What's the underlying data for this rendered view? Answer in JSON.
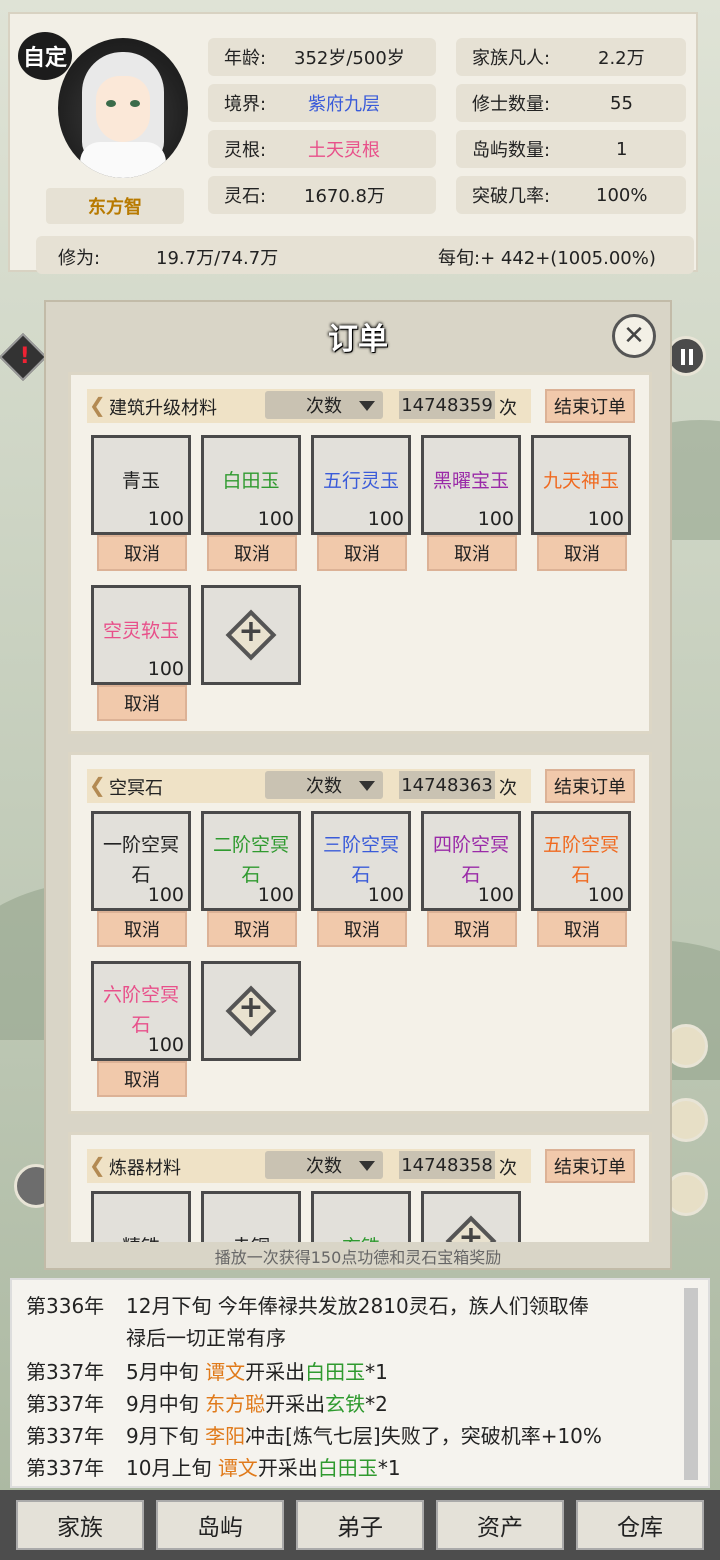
{
  "profile": {
    "badge": "自定",
    "name": "东方智",
    "stats": [
      {
        "label": "年龄:",
        "value": "352岁/500岁",
        "color": "#222222"
      },
      {
        "label": "境界:",
        "value": "紫府九层",
        "color": "#3a5bd9"
      },
      {
        "label": "灵根:",
        "value": "土天灵根",
        "color": "#e8508a"
      },
      {
        "label": "灵石:",
        "value": "1670.8万",
        "color": "#222222"
      }
    ],
    "family_stats": [
      {
        "label": "家族凡人:",
        "value": "2.2万"
      },
      {
        "label": "修士数量:",
        "value": "55"
      },
      {
        "label": "岛屿数量:",
        "value": "1"
      },
      {
        "label": "突破几率:",
        "value": "100%"
      }
    ],
    "cultivation_label": "修为:",
    "cultivation_value": "19.7万/74.7万",
    "per_period": "每旬:+ 442+(1005.00%)"
  },
  "modal": {
    "title": "订单",
    "close_icon": "close-icon",
    "mode_label": "次数",
    "times_suffix": "次",
    "end_label": "结束订单",
    "cancel_label": "取消",
    "orders": [
      {
        "name": "建筑升级材料",
        "count": "14748359",
        "items": [
          {
            "name": "青玉",
            "qty": "100",
            "color": "#222222"
          },
          {
            "name": "白田玉",
            "qty": "100",
            "color": "#2f9a2f"
          },
          {
            "name": "五行灵玉",
            "qty": "100",
            "color": "#3a5bd9"
          },
          {
            "name": "黑曜宝玉",
            "qty": "100",
            "color": "#9a2aa8"
          },
          {
            "name": "九天神玉",
            "qty": "100",
            "color": "#f06a20"
          },
          {
            "name": "空灵软玉",
            "qty": "100",
            "color": "#e8508a"
          }
        ]
      },
      {
        "name": "空冥石",
        "count": "14748363",
        "items": [
          {
            "name": "一阶空冥石",
            "line1": "一阶空冥",
            "line2": "石",
            "qty": "100",
            "color": "#222222"
          },
          {
            "name": "二阶空冥石",
            "line1": "二阶空冥",
            "line2": "石",
            "qty": "100",
            "color": "#2f9a2f"
          },
          {
            "name": "三阶空冥石",
            "line1": "三阶空冥",
            "line2": "石",
            "qty": "100",
            "color": "#3a5bd9"
          },
          {
            "name": "四阶空冥石",
            "line1": "四阶空冥",
            "line2": "石",
            "qty": "100",
            "color": "#9a2aa8"
          },
          {
            "name": "五阶空冥石",
            "line1": "五阶空冥",
            "line2": "石",
            "qty": "100",
            "color": "#f06a20"
          },
          {
            "name": "六阶空冥石",
            "line1": "六阶空冥",
            "line2": "石",
            "qty": "100",
            "color": "#e8508a"
          }
        ]
      },
      {
        "name": "炼器材料",
        "count": "14748358",
        "items": [
          {
            "name": "精铁",
            "qty": "",
            "color": "#222222"
          },
          {
            "name": "赤铜",
            "qty": "",
            "color": "#222222"
          },
          {
            "name": "玄铁",
            "qty": "",
            "color": "#2f9a2f"
          }
        ]
      }
    ]
  },
  "ad_text": "播放一次获得150点功德和灵石宝箱奖励",
  "log": [
    {
      "year": "第336年",
      "parts": [
        {
          "t": "12月下旬 今年俸禄共发放2810灵石，族人们领取俸",
          "c": ""
        }
      ]
    },
    {
      "year": "",
      "parts": [
        {
          "t": "禄后一切正常有序",
          "c": ""
        }
      ]
    },
    {
      "year": "第337年",
      "parts": [
        {
          "t": "5月中旬 ",
          "c": ""
        },
        {
          "t": "谭文",
          "c": "orange"
        },
        {
          "t": "开采出",
          "c": ""
        },
        {
          "t": "白田玉",
          "c": "green"
        },
        {
          "t": "*1",
          "c": ""
        }
      ]
    },
    {
      "year": "第337年",
      "parts": [
        {
          "t": "9月中旬 ",
          "c": ""
        },
        {
          "t": "东方聪",
          "c": "orange"
        },
        {
          "t": "开采出",
          "c": ""
        },
        {
          "t": "玄铁",
          "c": "green"
        },
        {
          "t": "*2",
          "c": ""
        }
      ]
    },
    {
      "year": "第337年",
      "parts": [
        {
          "t": "9月下旬 ",
          "c": ""
        },
        {
          "t": "李阳",
          "c": "orange"
        },
        {
          "t": "冲击[炼气七层]失败了，突破机率+10%",
          "c": ""
        }
      ]
    },
    {
      "year": "第337年",
      "parts": [
        {
          "t": "10月上旬 ",
          "c": ""
        },
        {
          "t": "谭文",
          "c": "orange"
        },
        {
          "t": "开采出",
          "c": ""
        },
        {
          "t": "白田玉",
          "c": "green"
        },
        {
          "t": "*1",
          "c": ""
        }
      ]
    }
  ],
  "nav": [
    "家族",
    "岛屿",
    "弟子",
    "资产",
    "仓库"
  ]
}
